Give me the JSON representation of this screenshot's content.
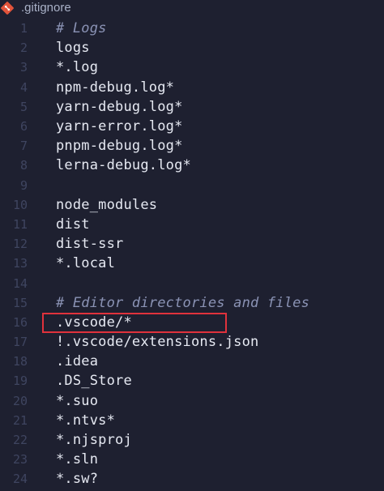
{
  "tab": {
    "title": ".gitignore",
    "icon": "git-file-icon"
  },
  "colors": {
    "background": "#1e2030",
    "text": "#e6e9f2",
    "comment": "#8b93b5",
    "line_number": "#3f4560",
    "highlight_border": "#e0323c",
    "git_icon": "#e2543b"
  },
  "lines": [
    {
      "n": "1",
      "text": "# Logs",
      "comment": true
    },
    {
      "n": "2",
      "text": "logs"
    },
    {
      "n": "3",
      "text": "*.log"
    },
    {
      "n": "4",
      "text": "npm-debug.log*"
    },
    {
      "n": "5",
      "text": "yarn-debug.log*"
    },
    {
      "n": "6",
      "text": "yarn-error.log*"
    },
    {
      "n": "7",
      "text": "pnpm-debug.log*"
    },
    {
      "n": "8",
      "text": "lerna-debug.log*"
    },
    {
      "n": "9",
      "text": ""
    },
    {
      "n": "10",
      "text": "node_modules"
    },
    {
      "n": "11",
      "text": "dist"
    },
    {
      "n": "12",
      "text": "dist-ssr"
    },
    {
      "n": "13",
      "text": "*.local"
    },
    {
      "n": "14",
      "text": ""
    },
    {
      "n": "15",
      "text": "# Editor directories and files",
      "comment": true
    },
    {
      "n": "16",
      "text": ".vscode/*",
      "highlighted": true
    },
    {
      "n": "17",
      "text": "!.vscode/extensions.json"
    },
    {
      "n": "18",
      "text": ".idea"
    },
    {
      "n": "19",
      "text": ".DS_Store"
    },
    {
      "n": "20",
      "text": "*.suo"
    },
    {
      "n": "21",
      "text": "*.ntvs*"
    },
    {
      "n": "22",
      "text": "*.njsproj"
    },
    {
      "n": "23",
      "text": "*.sln"
    },
    {
      "n": "24",
      "text": "*.sw?"
    }
  ]
}
